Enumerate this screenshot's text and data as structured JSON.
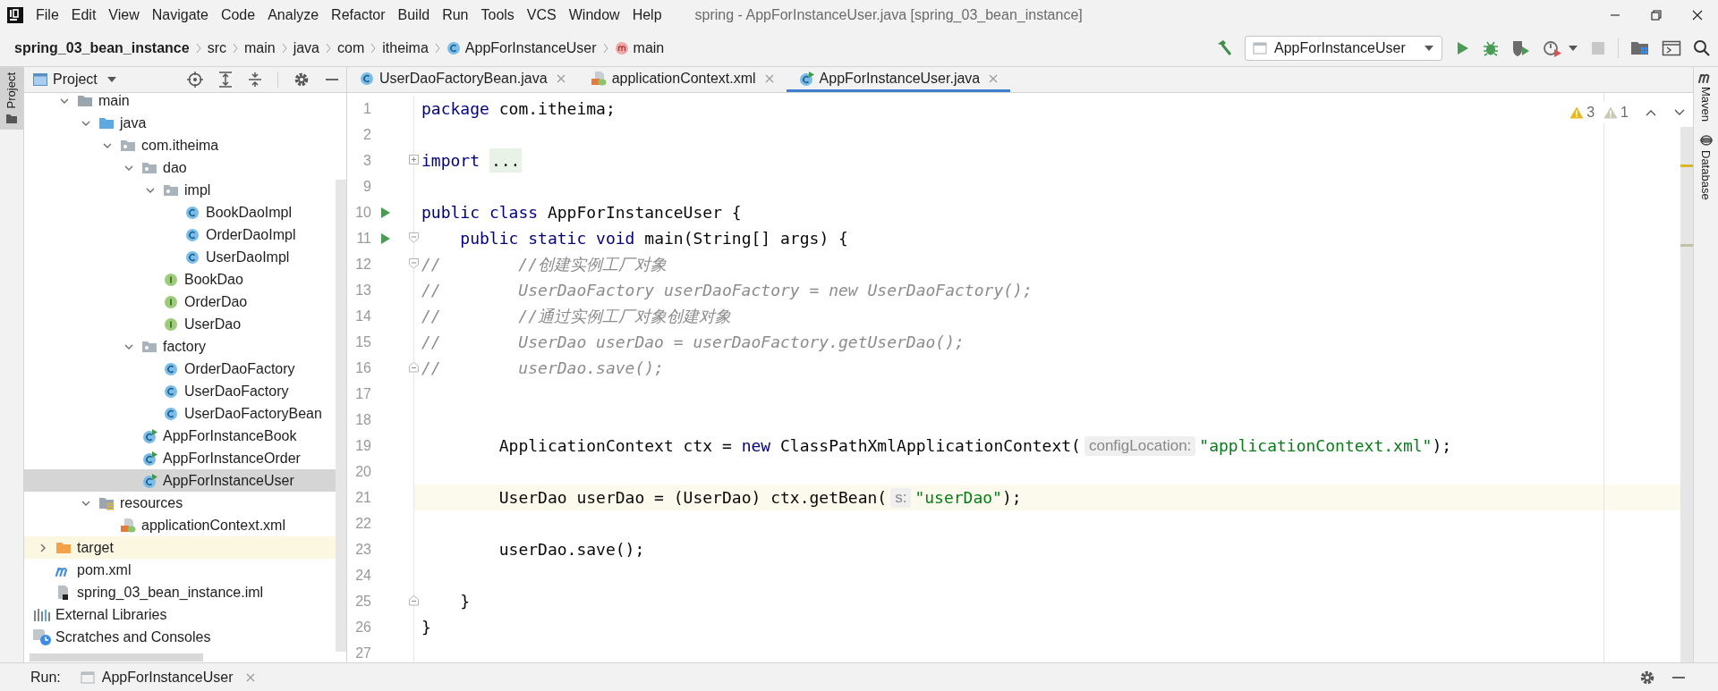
{
  "menu": [
    "File",
    "Edit",
    "View",
    "Navigate",
    "Code",
    "Analyze",
    "Refactor",
    "Build",
    "Run",
    "Tools",
    "VCS",
    "Window",
    "Help"
  ],
  "window_title": "spring - AppForInstanceUser.java [spring_03_bean_instance]",
  "breadcrumb": [
    {
      "text": "spring_03_bean_instance",
      "kind": "project"
    },
    {
      "text": "src",
      "kind": "folder"
    },
    {
      "text": "main",
      "kind": "folder"
    },
    {
      "text": "java",
      "kind": "folder"
    },
    {
      "text": "com",
      "kind": "folder"
    },
    {
      "text": "itheima",
      "kind": "folder"
    },
    {
      "text": "AppForInstanceUser",
      "kind": "class"
    },
    {
      "text": "main",
      "kind": "method"
    }
  ],
  "run_config": "AppForInstanceUser",
  "left_tool": {
    "label": "Project",
    "selected": true
  },
  "project_panel": {
    "title": "Project",
    "tree": [
      {
        "children": [
          {
            "children": [
              {
                "label": "main",
                "kind": "folder",
                "expanded": true,
                "selected": false,
                "children": [
                  {
                    "label": "java",
                    "kind": "source-folder",
                    "expanded": true,
                    "selected": false,
                    "children": [
                      {
                        "label": "com.itheima",
                        "kind": "package",
                        "expanded": true,
                        "selected": false,
                        "children": [
                          {
                            "label": "dao",
                            "kind": "package",
                            "expanded": true,
                            "selected": false,
                            "children": [
                              {
                                "label": "impl",
                                "kind": "package",
                                "expanded": true,
                                "selected": false,
                                "children": [
                                  {
                                    "label": "BookDaoImpl",
                                    "kind": "class",
                                    "selected": false
                                  },
                                  {
                                    "label": "OrderDaoImpl",
                                    "kind": "class",
                                    "selected": false
                                  },
                                  {
                                    "label": "UserDaoImpl",
                                    "kind": "class",
                                    "selected": false
                                  }
                                ]
                              },
                              {
                                "label": "BookDao",
                                "kind": "interface",
                                "selected": false
                              },
                              {
                                "label": "OrderDao",
                                "kind": "interface",
                                "selected": false
                              },
                              {
                                "label": "UserDao",
                                "kind": "interface",
                                "selected": false
                              }
                            ]
                          },
                          {
                            "label": "factory",
                            "kind": "package",
                            "expanded": true,
                            "selected": false,
                            "children": [
                              {
                                "label": "OrderDaoFactory",
                                "kind": "class",
                                "selected": false
                              },
                              {
                                "label": "UserDaoFactory",
                                "kind": "class",
                                "selected": false
                              },
                              {
                                "label": "UserDaoFactoryBean",
                                "kind": "class",
                                "selected": false
                              }
                            ]
                          },
                          {
                            "label": "AppForInstanceBook",
                            "kind": "runnable-class",
                            "selected": false
                          },
                          {
                            "label": "AppForInstanceOrder",
                            "kind": "runnable-class",
                            "selected": false
                          },
                          {
                            "label": "AppForInstanceUser",
                            "kind": "runnable-class",
                            "selected": true
                          }
                        ]
                      }
                    ]
                  },
                  {
                    "label": "resources",
                    "kind": "resources-folder",
                    "expanded": true,
                    "selected": false,
                    "children": [
                      {
                        "label": "applicationContext.xml",
                        "kind": "xml",
                        "selected": false
                      }
                    ]
                  }
                ]
              }
            ]
          },
          {
            "label": "target",
            "kind": "excluded-folder",
            "expanded": false,
            "selected": false
          },
          {
            "label": "pom.xml",
            "kind": "maven",
            "selected": false
          },
          {
            "label": "spring_03_bean_instance.iml",
            "kind": "iml",
            "selected": false
          }
        ]
      },
      {
        "label": "External Libraries",
        "kind": "libraries",
        "selected": false
      },
      {
        "label": "Scratches and Consoles",
        "kind": "scratches",
        "selected": false
      }
    ]
  },
  "tabs": [
    {
      "label": "UserDaoFactoryBean.java",
      "kind": "class",
      "selected": false
    },
    {
      "label": "applicationContext.xml",
      "kind": "xml",
      "selected": false
    },
    {
      "label": "AppForInstanceUser.java",
      "kind": "runnable-class",
      "selected": true
    }
  ],
  "inspections": [
    {
      "kind": "warning",
      "count": "3"
    },
    {
      "kind": "weak-warning",
      "count": "1"
    }
  ],
  "code": [
    {
      "number": "1",
      "run": false,
      "current": false,
      "tokens": [
        {
          "kind": "keyword",
          "text": "package"
        },
        {
          "kind": "plain",
          "text": " com.itheima;"
        }
      ]
    },
    {
      "number": "2",
      "run": false,
      "current": false
    },
    {
      "number": "3",
      "run": false,
      "current": false,
      "fold": {
        "kind": "expand"
      },
      "tokens": [
        {
          "kind": "keyword",
          "text": "import"
        },
        {
          "kind": "folded",
          "text": " ..."
        }
      ]
    },
    {
      "number": "9",
      "run": false,
      "current": false
    },
    {
      "number": "10",
      "run": true,
      "current": false,
      "tokens": [
        {
          "kind": "keyword",
          "text": "public"
        },
        {
          "kind": "keyword",
          "text": " class"
        },
        {
          "kind": "plain",
          "text": " AppForInstanceUser {"
        }
      ]
    },
    {
      "number": "11",
      "run": true,
      "current": false,
      "fold": {
        "kind": "start"
      },
      "tokens": [
        {
          "kind": "keyword",
          "text": "    public"
        },
        {
          "kind": "keyword",
          "text": " static"
        },
        {
          "kind": "keyword",
          "text": " void"
        },
        {
          "kind": "plain",
          "text": " main(String[] args) {"
        }
      ]
    },
    {
      "number": "12",
      "run": false,
      "current": false,
      "fold": {
        "kind": "start"
      },
      "tokens": [
        {
          "kind": "comment",
          "text": "//        //创建实例工厂对象"
        }
      ]
    },
    {
      "number": "13",
      "run": false,
      "current": false,
      "tokens": [
        {
          "kind": "comment",
          "text": "//        UserDaoFactory userDaoFactory = new UserDaoFactory();"
        }
      ]
    },
    {
      "number": "14",
      "run": false,
      "current": false,
      "tokens": [
        {
          "kind": "comment",
          "text": "//        //通过实例工厂对象创建对象"
        }
      ]
    },
    {
      "number": "15",
      "run": false,
      "current": false,
      "tokens": [
        {
          "kind": "comment",
          "text": "//        UserDao userDao = userDaoFactory.getUserDao();"
        }
      ]
    },
    {
      "number": "16",
      "run": false,
      "current": false,
      "fold": {
        "kind": "end"
      },
      "tokens": [
        {
          "kind": "comment",
          "text": "//        userDao.save();"
        }
      ]
    },
    {
      "number": "17",
      "run": false,
      "current": false
    },
    {
      "number": "18",
      "run": false,
      "current": false
    },
    {
      "number": "19",
      "run": false,
      "current": false,
      "tokens": [
        {
          "kind": "plain",
          "text": "        ApplicationContext ctx = "
        },
        {
          "kind": "keyword",
          "text": "new"
        },
        {
          "kind": "plain",
          "text": " ClassPathXmlApplicationContext("
        },
        {
          "kind": "hint",
          "text": "configLocation:"
        },
        {
          "kind": "string",
          "text": "\"applicationContext.xml\""
        },
        {
          "kind": "plain",
          "text": ");"
        }
      ]
    },
    {
      "number": "20",
      "run": false,
      "current": false
    },
    {
      "number": "21",
      "run": false,
      "current": true,
      "tokens": [
        {
          "kind": "plain",
          "text": "        UserDao userDao = (UserDao) ctx.getBean("
        },
        {
          "kind": "hint",
          "text": "s:"
        },
        {
          "kind": "string",
          "text": "\"userDao\""
        },
        {
          "kind": "plain",
          "text": ");"
        }
      ]
    },
    {
      "number": "22",
      "run": false,
      "current": false
    },
    {
      "number": "23",
      "run": false,
      "current": false,
      "tokens": [
        {
          "kind": "plain",
          "text": "        userDao.save();"
        }
      ]
    },
    {
      "number": "24",
      "run": false,
      "current": false
    },
    {
      "number": "25",
      "run": false,
      "current": false,
      "fold": {
        "kind": "end"
      },
      "tokens": [
        {
          "kind": "plain",
          "text": "    }"
        }
      ]
    },
    {
      "number": "26",
      "run": false,
      "current": false,
      "tokens": [
        {
          "kind": "plain",
          "text": "}"
        }
      ]
    },
    {
      "number": "27",
      "run": false,
      "current": false
    }
  ],
  "side_tools": [
    {
      "label": "Maven",
      "kind": "maven"
    },
    {
      "label": "Database",
      "kind": "database"
    }
  ],
  "run_bar": {
    "label": "Run:",
    "tab": "AppForInstanceUser"
  }
}
